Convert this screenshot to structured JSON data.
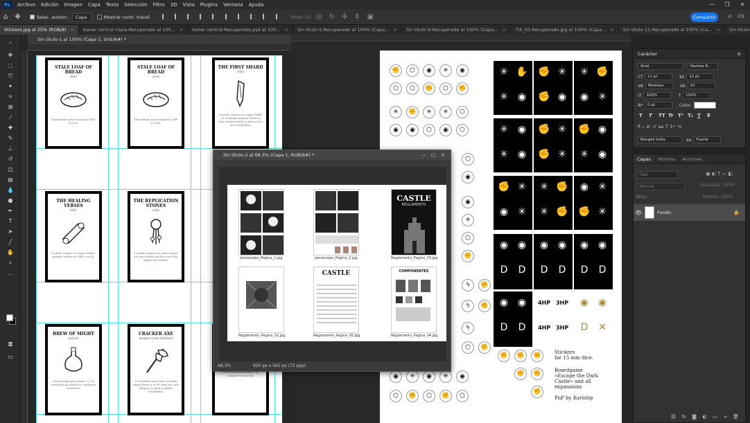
{
  "menubar": {
    "logo": "Ps",
    "items": [
      "Archivo",
      "Edición",
      "Imagen",
      "Capa",
      "Texto",
      "Selección",
      "Filtro",
      "3D",
      "Vista",
      "Plugins",
      "Ventana",
      "Ayuda"
    ]
  },
  "options": {
    "auto_select_label": "Selec. autom.:",
    "auto_select_value": "Capa",
    "transform_label": "Mostrar contr. transf.",
    "mode3d_label": "Modo 3D:",
    "share_label": "Compartir"
  },
  "tabs": [
    "Stickers.jpg al 25% (RGB/8)",
    "baner central copia-Recuperado al 100...",
    "baner central-Recuperado.psd al 100...",
    "Sin título-5-Recuperado al 100% (Capa...",
    "Sin título-9-Recuperado al 100% (Capa...",
    "7th_01-Recuperado.jpg al 100% (Capa...",
    "Sin título-11-Recuperado al 100% (Ca...",
    "Sin título-10-Recuperado al 66,7% (Ca..."
  ],
  "doc1": {
    "title": "Sin título-1 al 100% (Capa 1, Gris/8#) *",
    "cards": [
      {
        "title": "STALE LOAF OF BREAD",
        "sub": "food",
        "desc": "Descártala para restaurar 1HP a tu PJ."
      },
      {
        "title": "STALE LOAF OF BREAD",
        "sub": "food",
        "desc": "Descártala para restaurar 1HP a tu PJ."
      },
      {
        "title": "THE FIRST SHARD",
        "sub": "relic",
        "desc": "Cuando sugues un signo Doble en combate puedes volver a tirar ambos dados y ofrecer los dos resultados."
      },
      {
        "title": "THE HEALING VERSES",
        "sub": "relic",
        "desc": "Cuando sugues un signo Doble, puedes restaurar 1HP a tu PJ."
      },
      {
        "title": "THE REPLICATION STONES",
        "sub": "relic",
        "desc": "Cuando sugues un único signo en una tirada cambia como los signos del mismo."
      },
      {
        "title": "BREW OF MIGHT",
        "sub": "potion",
        "desc": "Descártala para añadir +1 al resultado de poder en cualquier momento."
      },
      {
        "title": "CRACKER AXE",
        "sub": "weapon (one-handed)",
        "desc": "Un tiradela para tirar un dado negro junto a tu PJ cada vez que ataques y gana a ambos resultados."
      },
      {
        "title": "",
        "sub": "",
        "desc": "Descártala para añadir en cualquier momento."
      }
    ]
  },
  "floatwin": {
    "title": "Sin título-2 al 68,3% (Capa 1, RGB/8#) *",
    "zoom": "68,3%",
    "size": "820 px x 562 px (72 ppp)",
    "thumbs": [
      {
        "label": "personajes_Pagina_1.jpg",
        "heading": ""
      },
      {
        "label": "personajes_Pagina_2.jpg",
        "heading": ""
      },
      {
        "label": "Reglamento_Pagina_33.jpg",
        "heading": "CASTLE"
      },
      {
        "label": "Reglamento_Pagina_32.jpg",
        "heading": ""
      },
      {
        "label": "Reglamento_Pagina_05.jpg",
        "heading": "CASTLE"
      },
      {
        "label": "Reglamento_Pagina_34.jpg",
        "heading": "COMPONENTES"
      }
    ],
    "sub_heading": "REGLAMENTO"
  },
  "sheet": {
    "text": [
      "Stickers",
      "for 15 mm dice.",
      "Boardgame",
      "«Escape the Dark",
      "Castle» and all",
      "expansions",
      "PnP by Kariotip"
    ],
    "hp_labels": [
      "4HP",
      "3HP",
      "4HP",
      "3HP"
    ]
  },
  "character": {
    "title": "Carácter",
    "font_family": "Arial",
    "font_style": "Narrow B...",
    "size": "11 pt",
    "leading": "12 pt",
    "kerning": "Medidas",
    "tracking": "10",
    "vscale": "100%",
    "hscale": "100%",
    "baseline": "0 pt",
    "color_label": "Color:",
    "style_buttons": [
      "T",
      "T",
      "TT",
      "Tr",
      "T¹",
      "T₁",
      "T",
      "T"
    ],
    "language": "Bengalí India",
    "aa": "Fuerte"
  },
  "layers": {
    "tabs": [
      "Capas",
      "Historia",
      "Acciones"
    ],
    "search_placeholder": "Tipo",
    "blend_mode": "Normal",
    "opacity_label": "Opacidad: 100%",
    "fill_label": "Relleno: 100%",
    "lock_label": "Bloq.:",
    "layer_name": "Fondo"
  },
  "colors": {
    "accent": "#1473e6",
    "guide": "#4ee0e8"
  }
}
